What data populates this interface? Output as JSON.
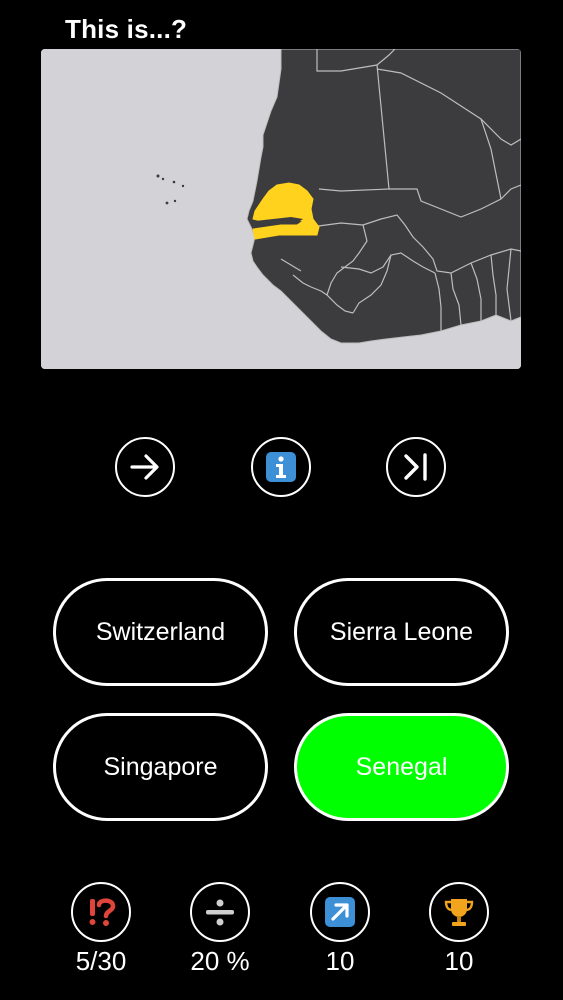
{
  "question": {
    "title": "This is...?"
  },
  "map": {
    "background_color": "#d3d2d6",
    "land_color": "#3c3c3e",
    "border_color": "#bdbdbd",
    "highlight_color": "#ffd21e"
  },
  "controls": {
    "next_icon": "arrow-right-icon",
    "info_icon": "info-icon",
    "skip_icon": "skip-end-icon"
  },
  "answers": [
    {
      "label": "Switzerland",
      "state": "default"
    },
    {
      "label": "Sierra Leone",
      "state": "default"
    },
    {
      "label": "Singapore",
      "state": "default"
    },
    {
      "label": "Senegal",
      "state": "correct"
    }
  ],
  "colors": {
    "correct": "#00ff00",
    "hint": "#e0453b",
    "info": "#3d8fd6",
    "trophy": "#f2a41c"
  },
  "stats": {
    "questions": {
      "icon": "exclamation-question-icon",
      "value": "5/30"
    },
    "accuracy": {
      "icon": "divide-icon",
      "value": "20 %"
    },
    "score": {
      "icon": "arrow-up-right-icon",
      "value": "10"
    },
    "best": {
      "icon": "trophy-icon",
      "value": "10"
    }
  }
}
